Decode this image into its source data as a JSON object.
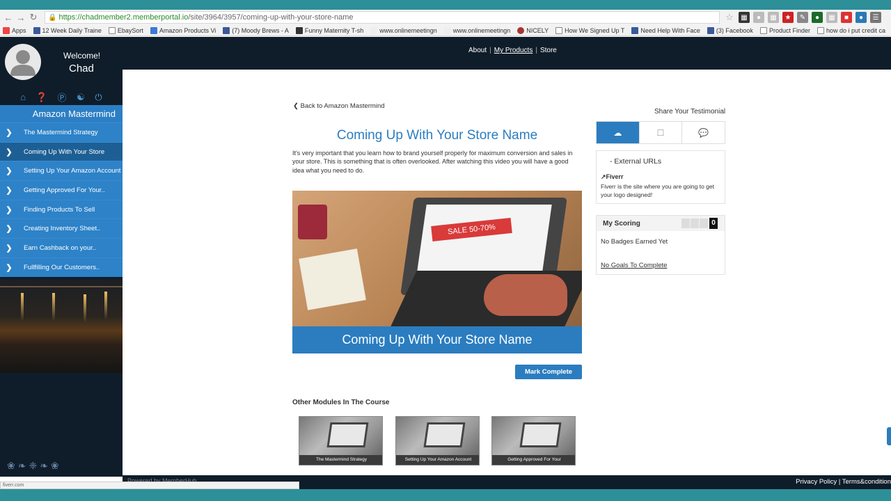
{
  "browser": {
    "url_host": "https://chadmember2.memberportal.io",
    "url_path": "/site/3964/3957/coming-up-with-your-store-name",
    "bookmarks": [
      "Apps",
      "12 Week Daily Traine",
      "EbaySort",
      "Amazon Products Vi",
      "(7) Moody Brews - A",
      "Funny Maternity T-sh",
      "www.onlinemeetingn",
      "www.onlinemeetingn",
      "NICELY",
      "How We Signed Up T",
      "Need Help With Face",
      "(3) Facebook",
      "Product Finder",
      "how do i put credit ca"
    ],
    "status_text": "fiverr.com"
  },
  "sidebar": {
    "welcome": "Welcome!",
    "user_name": "Chad",
    "course_title": "Amazon Mastermind",
    "items": [
      {
        "label": "The Mastermind Strategy"
      },
      {
        "label": "Coming Up With Your Store"
      },
      {
        "label": "Setting Up Your Amazon Account"
      },
      {
        "label": "Getting Approved For Your.."
      },
      {
        "label": "Finding Products To Sell"
      },
      {
        "label": "Creating Inventory Sheet.."
      },
      {
        "label": "Earn Cashback on your.."
      },
      {
        "label": "Fullfilling Our Customers.."
      }
    ]
  },
  "header": {
    "about": "About",
    "my_products": "My Products",
    "store": "Store"
  },
  "main": {
    "back_link": "Back to Amazon Mastermind",
    "title": "Coming Up With Your Store Name",
    "intro": "It's very important that you learn how to brand yourself properly for maximum conversion and sales in your store. This is something that is often overlooked. After watching this video you will have a good idea what you need to do.",
    "hero_sale_text": "SALE 50-70%",
    "hero_caption": "Coming Up With Your Store Name",
    "mark_complete": "Mark Complete",
    "other_modules_title": "Other Modules In The Course",
    "other_modules": [
      {
        "caption": "The Mastermind Strategy"
      },
      {
        "caption": "Setting Up Your Amazon Account"
      },
      {
        "caption": "Getting Approved For Your"
      }
    ]
  },
  "right_panel": {
    "share_title": "Share Your Testimonial",
    "external_urls_heading": "- External URLs",
    "link_label": "Fiverr",
    "link_desc": "Fiverr is the site where you are going to get your logo designed!",
    "scoring_title": "My Scoring",
    "score_value": "0",
    "badges_text": "No Badges Earned Yet",
    "goals_text": "No Goals To Complete"
  },
  "footer": {
    "powered": "Powered by MemberHub",
    "privacy": "Privacy Policy",
    "terms": "Terms&condition"
  },
  "colors": {
    "brand_blue": "#2b7dc0",
    "dark_navy": "#0f1d2a",
    "frame_teal": "#2d8f98"
  }
}
